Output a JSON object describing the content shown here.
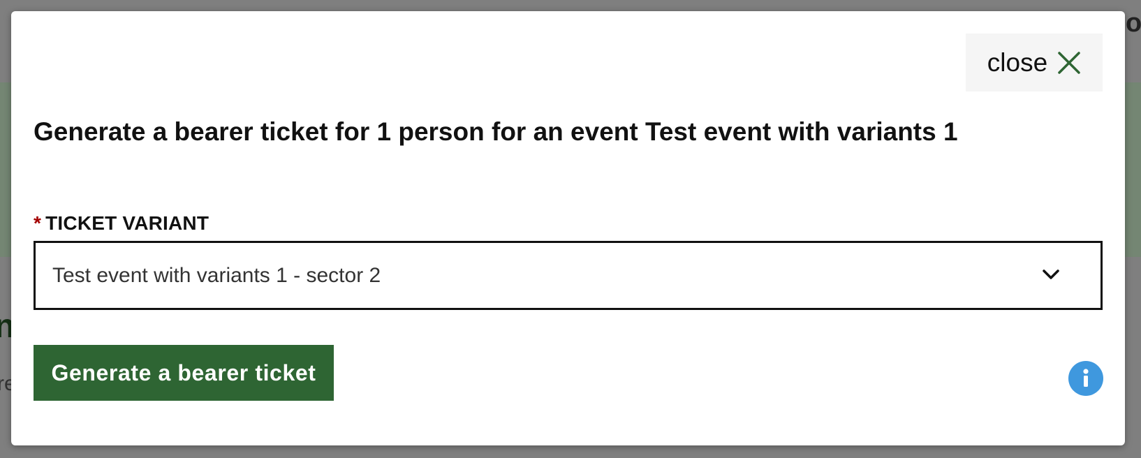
{
  "modal": {
    "close_label": "close",
    "title": "Generate a bearer ticket for 1 person for an event Test event with variants 1",
    "field": {
      "required_marker": "*",
      "label": "TICKET VARIANT",
      "selected_value": "Test event with variants 1 - sector 2"
    },
    "submit_label": "Generate a bearer ticket",
    "icons": {
      "close": "close-icon",
      "dropdown": "chevron-down-icon",
      "info": "info-icon"
    }
  },
  "colors": {
    "primary": "#2e6533",
    "close_icon": "#2e6533",
    "info": "#3f98de",
    "required": "#a40000",
    "overlay": "#7f7f7f"
  }
}
